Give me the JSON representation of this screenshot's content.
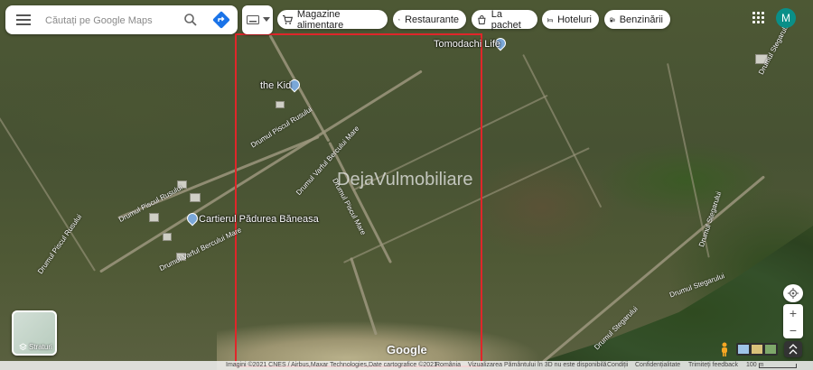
{
  "search": {
    "placeholder": "Căutați pe Google Maps"
  },
  "chips": [
    {
      "label": "Magazine alimentare",
      "icon": "cart-icon"
    },
    {
      "label": "Restaurante",
      "icon": "fork-knife-icon"
    },
    {
      "label": "La pachet",
      "icon": "takeout-bag-icon"
    },
    {
      "label": "Hoteluri",
      "icon": "bed-icon"
    },
    {
      "label": "Benzinării",
      "icon": "gas-pump-icon"
    }
  ],
  "account": {
    "initial": "M",
    "color": "#0a8f88"
  },
  "map": {
    "places": [
      {
        "name": "Tomodachi Life"
      },
      {
        "name": "the Kid"
      },
      {
        "name": "Cartierul Pădurea Băneasa"
      }
    ],
    "roads": [
      {
        "name": "Drumul Piscul Rusului"
      },
      {
        "name": "Drumul Piscul Rusului"
      },
      {
        "name": "Drumul Piscul Rusului"
      },
      {
        "name": "Drumul Varful Bercului Mare"
      },
      {
        "name": "Drumul Varful Bercului Mare"
      },
      {
        "name": "Drumul Piscul Mare"
      },
      {
        "name": "Drumul Stegarului"
      },
      {
        "name": "Drumul Stegarului"
      },
      {
        "name": "Drumul Stegarului"
      },
      {
        "name": "Drumul Stegarului"
      }
    ],
    "watermark": "DejaVulmobiliare",
    "brand": "Google"
  },
  "layers": {
    "label": "Straturi"
  },
  "footer": {
    "imagery": "Imagini ©2021 CNES / Airbus,Maxar Technologies,Date cartografice ©2021",
    "country": "România",
    "note": "Vizualizarea Pământului în 3D nu este disponibilă",
    "terms": "Condiții",
    "privacy": "Confidențialitate",
    "feedback": "Trimiteți feedback",
    "scale": "100 m"
  },
  "colors": {
    "highlight_frame": "#e0262a",
    "accent_blue": "#1a73e8"
  }
}
